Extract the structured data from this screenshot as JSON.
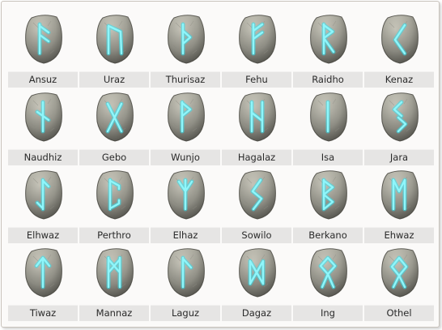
{
  "runes": [
    {
      "name": "Ansuz",
      "glyph": "ansuz-rune-icon"
    },
    {
      "name": "Uraz",
      "glyph": "uruz-rune-icon"
    },
    {
      "name": "Thurisaz",
      "glyph": "thurisaz-rune-icon"
    },
    {
      "name": "Fehu",
      "glyph": "fehu-rune-icon"
    },
    {
      "name": "Raidho",
      "glyph": "raidho-rune-icon"
    },
    {
      "name": "Kenaz",
      "glyph": "kenaz-rune-icon"
    },
    {
      "name": "Naudhiz",
      "glyph": "naudhiz-rune-icon"
    },
    {
      "name": "Gebo",
      "glyph": "gebo-rune-icon"
    },
    {
      "name": "Wunjo",
      "glyph": "wunjo-rune-icon"
    },
    {
      "name": "Hagalaz",
      "glyph": "hagalaz-rune-icon"
    },
    {
      "name": "Isa",
      "glyph": "isa-rune-icon"
    },
    {
      "name": "Jara",
      "glyph": "jara-rune-icon"
    },
    {
      "name": "Elhwaz",
      "glyph": "eihwaz-rune-icon"
    },
    {
      "name": "Perthro",
      "glyph": "perthro-rune-icon"
    },
    {
      "name": "Elhaz",
      "glyph": "elhaz-rune-icon"
    },
    {
      "name": "Sowilo",
      "glyph": "sowilo-rune-icon"
    },
    {
      "name": "Berkano",
      "glyph": "berkano-rune-icon"
    },
    {
      "name": "Ehwaz",
      "glyph": "ehwaz-rune-icon"
    },
    {
      "name": "Tiwaz",
      "glyph": "tiwaz-rune-icon"
    },
    {
      "name": "Mannaz",
      "glyph": "mannaz-rune-icon"
    },
    {
      "name": "Laguz",
      "glyph": "laguz-rune-icon"
    },
    {
      "name": "Dagaz",
      "glyph": "dagaz-rune-icon"
    },
    {
      "name": "Ing",
      "glyph": "ing-rune-icon"
    },
    {
      "name": "Othel",
      "glyph": "othala-rune-icon"
    }
  ],
  "colors": {
    "stone_light": "#d4d2c6",
    "stone_mid": "#a9a89d",
    "stone_dark": "#6f6e66",
    "rune_glow": "#2ee0ef",
    "rune_core": "#8ff6fb",
    "label_bg": "#e6e5e4"
  }
}
